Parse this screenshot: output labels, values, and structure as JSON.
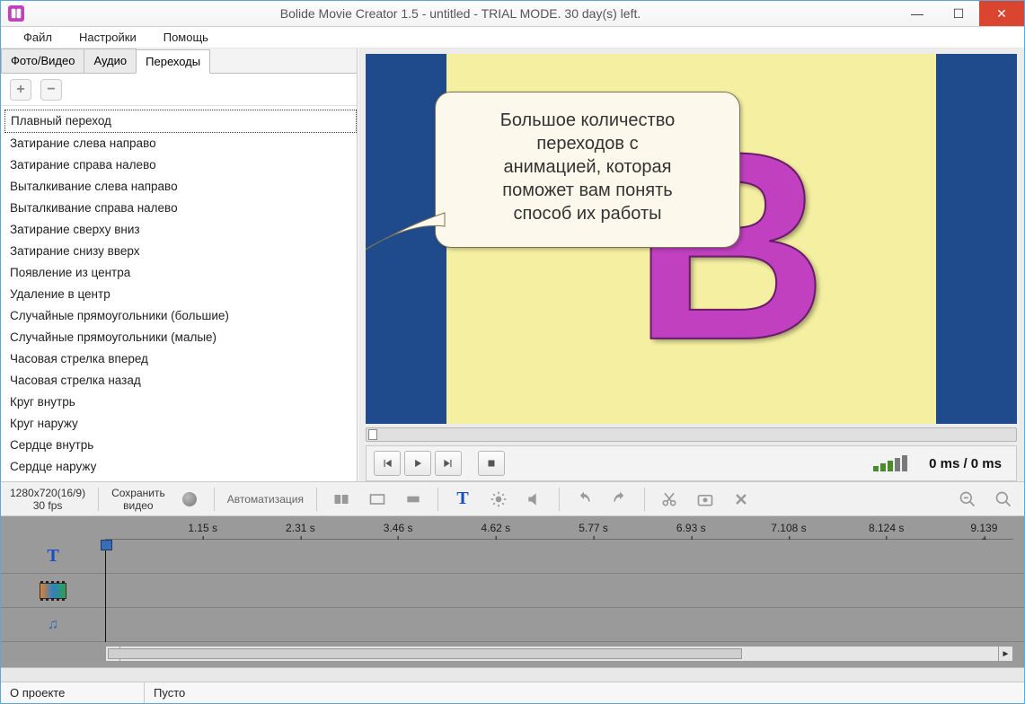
{
  "window": {
    "title": "Bolide Movie Creator 1.5 - untitled  - TRIAL MODE. 30 day(s) left."
  },
  "menu": {
    "file": "Файл",
    "settings": "Настройки",
    "help": "Помощь"
  },
  "tabs": {
    "photo_video": "Фото/Видео",
    "audio": "Аудио",
    "transitions": "Переходы"
  },
  "panel_toolbar": {
    "add": "+",
    "remove": "−"
  },
  "transitions": [
    "Плавный переход",
    "Затирание слева направо",
    "Затирание справа налево",
    "Выталкивание слева направо",
    "Выталкивание справа налево",
    "Затирание сверху вниз",
    "Затирание снизу вверх",
    "Появление из центра",
    "Удаление в центр",
    "Случайные прямоугольники (большие)",
    "Случайные прямоугольники (малые)",
    "Часовая стрелка вперед",
    "Часовая стрелка назад",
    "Круг внутрь",
    "Круг наружу",
    "Сердце внутрь",
    "Сердце наружу"
  ],
  "callout": {
    "l1": "Большое количество",
    "l2": "переходов с",
    "l3": "анимацией, которая",
    "l4": "поможет вам понять",
    "l5": "способ их работы"
  },
  "transport": {
    "time": "0 ms  / 0 ms"
  },
  "mid": {
    "resolution": "1280x720(16/9)",
    "fps": "30 fps",
    "save_video_l1": "Сохранить",
    "save_video_l2": "видео",
    "automation": "Автоматизация"
  },
  "ruler": {
    "ticks": [
      "1.15 s",
      "2.31 s",
      "3.46 s",
      "4.62 s",
      "5.77 s",
      "6.93 s",
      "7.108 s",
      "8.124 s",
      "9.139 s"
    ]
  },
  "status": {
    "about": "О проекте",
    "empty": "Пусто"
  }
}
